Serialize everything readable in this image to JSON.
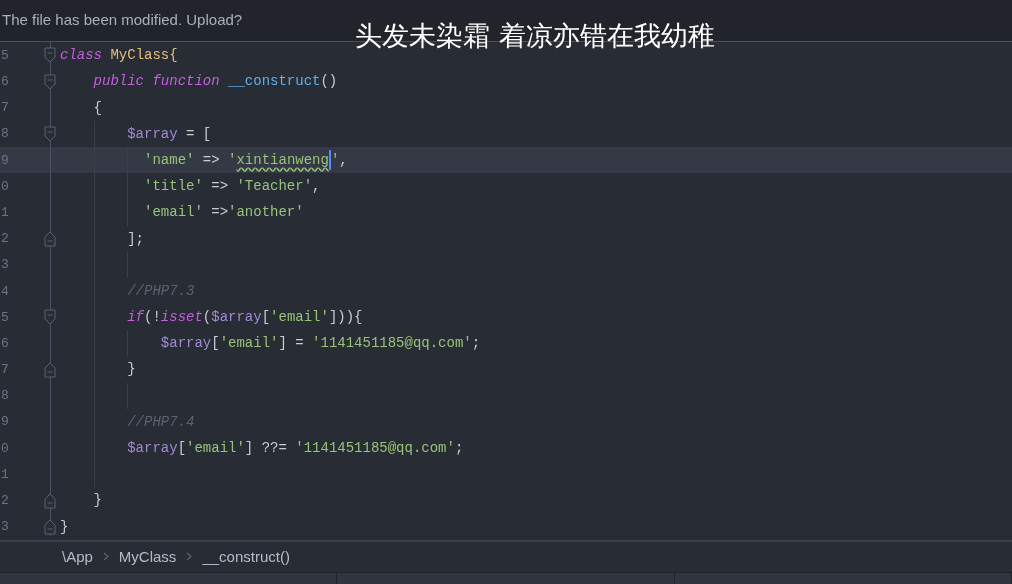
{
  "notification": "The file has been modified. Upload?",
  "caption": "头发未染霜 着凉亦错在我幼稚",
  "editor": {
    "lines": [
      {
        "number": "5",
        "fold_start": true,
        "fold_end": false,
        "current": false,
        "tokens": [
          {
            "text": "class ",
            "kind": "keyword"
          },
          {
            "text": "MyClass",
            "kind": "class"
          },
          {
            "text": "{",
            "kind": "brace"
          }
        ]
      },
      {
        "number": "6",
        "fold_start": true,
        "fold_end": false,
        "current": false,
        "tokens": [
          {
            "text": "    public ",
            "kind": "keyword"
          },
          {
            "text": "function ",
            "kind": "keyword"
          },
          {
            "text": "__construct",
            "kind": "func"
          },
          {
            "text": "()",
            "kind": "punct"
          }
        ]
      },
      {
        "number": "7",
        "fold_start": false,
        "fold_end": false,
        "current": false,
        "tokens": [
          {
            "text": "    {",
            "kind": "punct"
          }
        ]
      },
      {
        "number": "8",
        "fold_start": true,
        "fold_end": false,
        "current": false,
        "tokens": [
          {
            "text": "        $array",
            "kind": "var"
          },
          {
            "text": " = [",
            "kind": "punct"
          }
        ]
      },
      {
        "number": "9",
        "fold_start": false,
        "fold_end": false,
        "current": true,
        "tokens": [
          {
            "text": "          'name'",
            "kind": "string"
          },
          {
            "text": " => ",
            "kind": "punct"
          },
          {
            "text": "'",
            "kind": "string"
          },
          {
            "text": "xintianweng",
            "kind": "typo"
          },
          {
            "text": "'",
            "kind": "string"
          },
          {
            "text": ",",
            "kind": "punct"
          }
        ]
      },
      {
        "number": "0",
        "fold_start": false,
        "fold_end": false,
        "current": false,
        "tokens": [
          {
            "text": "          'title'",
            "kind": "string"
          },
          {
            "text": " => ",
            "kind": "punct"
          },
          {
            "text": "'Teacher'",
            "kind": "string"
          },
          {
            "text": ",",
            "kind": "punct"
          }
        ]
      },
      {
        "number": "1",
        "fold_start": false,
        "fold_end": false,
        "current": false,
        "tokens": [
          {
            "text": "          'email'",
            "kind": "string"
          },
          {
            "text": " =>",
            "kind": "punct"
          },
          {
            "text": "'another'",
            "kind": "string"
          }
        ]
      },
      {
        "number": "2",
        "fold_start": false,
        "fold_end": true,
        "current": false,
        "tokens": [
          {
            "text": "        ];",
            "kind": "punct"
          }
        ]
      },
      {
        "number": "3",
        "fold_start": false,
        "fold_end": false,
        "current": false
      },
      {
        "number": "4",
        "fold_start": false,
        "fold_end": false,
        "current": false,
        "tokens": [
          {
            "text": "        //PHP7.3",
            "kind": "comment"
          }
        ]
      },
      {
        "number": "5",
        "fold_start": true,
        "fold_end": false,
        "current": false,
        "tokens": [
          {
            "text": "        if",
            "kind": "keyword"
          },
          {
            "text": "(!",
            "kind": "punct"
          },
          {
            "text": "isset",
            "kind": "keyword"
          },
          {
            "text": "(",
            "kind": "punct"
          },
          {
            "text": "$array",
            "kind": "var"
          },
          {
            "text": "[",
            "kind": "punct"
          },
          {
            "text": "'email'",
            "kind": "string"
          },
          {
            "text": "])){",
            "kind": "punct"
          }
        ]
      },
      {
        "number": "6",
        "fold_start": false,
        "fold_end": false,
        "current": false,
        "tokens": [
          {
            "text": "            $array",
            "kind": "var"
          },
          {
            "text": "[",
            "kind": "punct"
          },
          {
            "text": "'email'",
            "kind": "string"
          },
          {
            "text": "] = ",
            "kind": "punct"
          },
          {
            "text": "'1141451185@qq.com'",
            "kind": "string"
          },
          {
            "text": ";",
            "kind": "punct"
          }
        ]
      },
      {
        "number": "7",
        "fold_start": false,
        "fold_end": true,
        "current": false,
        "tokens": [
          {
            "text": "        }",
            "kind": "punct"
          }
        ]
      },
      {
        "number": "8",
        "fold_start": false,
        "fold_end": false,
        "current": false
      },
      {
        "number": "9",
        "fold_start": false,
        "fold_end": false,
        "current": false,
        "tokens": [
          {
            "text": "        //PHP7.4",
            "kind": "comment"
          }
        ]
      },
      {
        "number": "0",
        "fold_start": false,
        "fold_end": false,
        "current": false,
        "tokens": [
          {
            "text": "        $array",
            "kind": "var"
          },
          {
            "text": "[",
            "kind": "punct"
          },
          {
            "text": "'email'",
            "kind": "string"
          },
          {
            "text": "] ??= ",
            "kind": "punct"
          },
          {
            "text": "'1141451185@qq.com'",
            "kind": "string"
          },
          {
            "text": ";",
            "kind": "punct"
          }
        ]
      },
      {
        "number": "1",
        "fold_start": false,
        "fold_end": false,
        "current": false
      },
      {
        "number": "2",
        "fold_start": false,
        "fold_end": true,
        "current": false,
        "tokens": [
          {
            "text": "    }",
            "kind": "punct"
          }
        ]
      },
      {
        "number": "3",
        "fold_start": false,
        "fold_end": true,
        "current": false,
        "tokens": [
          {
            "text": "}",
            "kind": "punct"
          }
        ]
      }
    ]
  },
  "breadcrumb": [
    "\\App",
    "MyClass",
    "__construct()"
  ]
}
